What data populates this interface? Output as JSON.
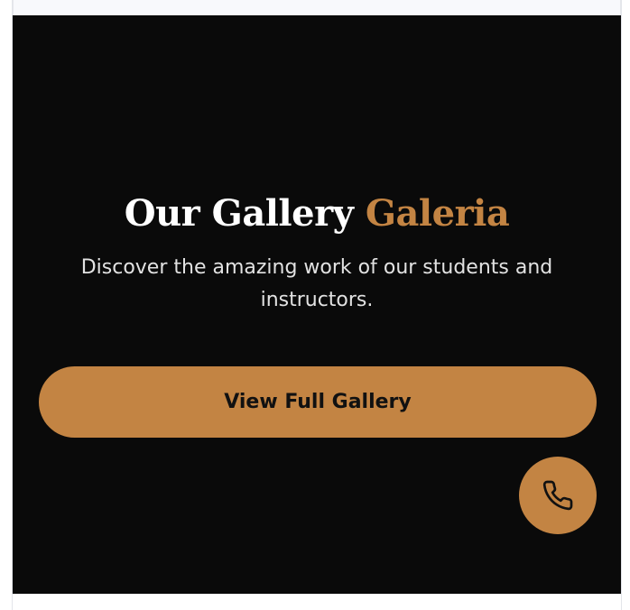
{
  "gallery": {
    "title_main": "Our Gallery",
    "title_accent": "Galeria",
    "subtitle": "Discover the amazing work of our students and instructors.",
    "button_label": "View Full Gallery"
  },
  "colors": {
    "background": "#0a0a0a",
    "accent": "#c38443",
    "title": "#ffffff",
    "subtitle": "#e2e2e2"
  },
  "fab": {
    "icon": "phone-icon"
  }
}
